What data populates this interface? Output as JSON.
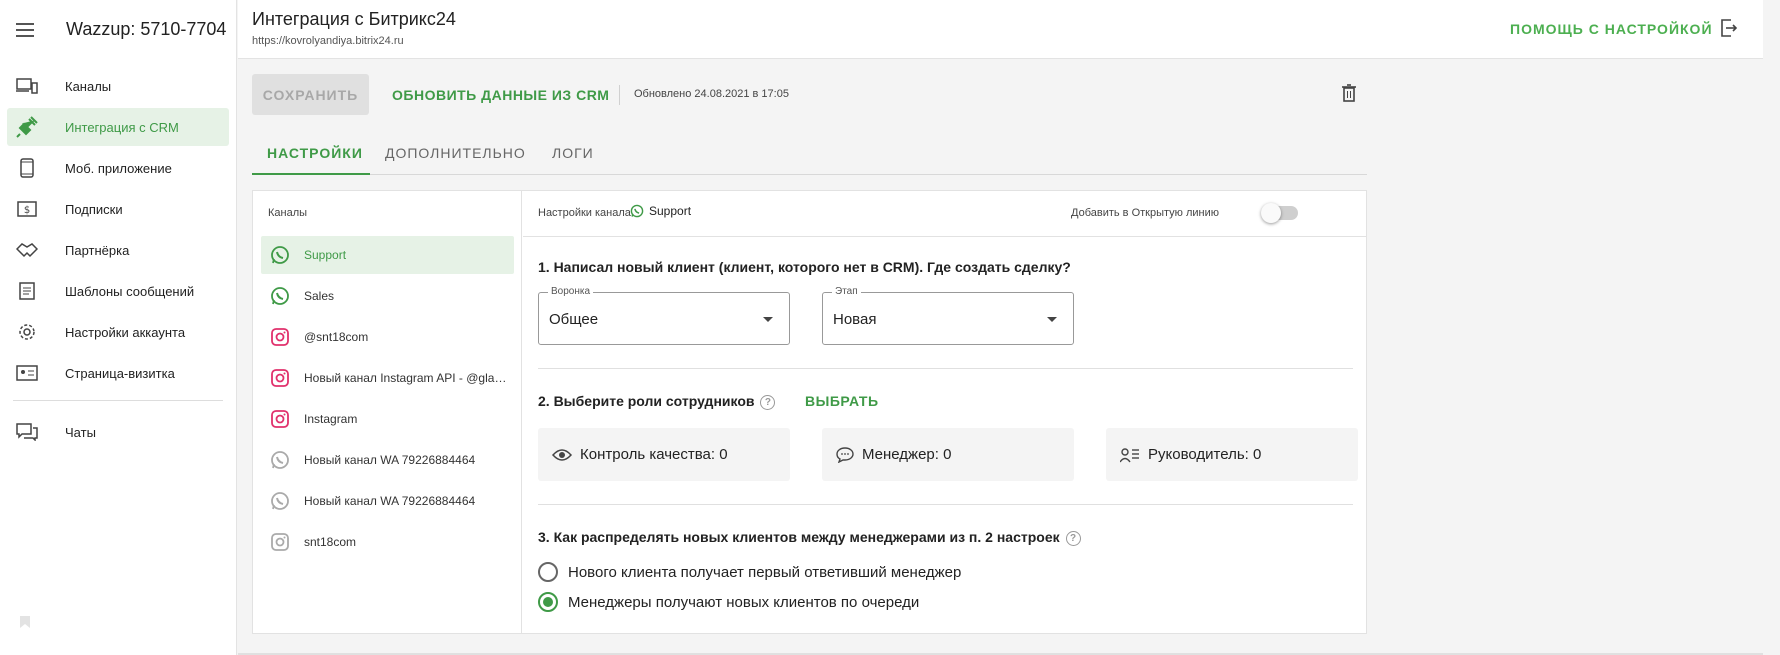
{
  "app": {
    "brand": "Wazzup: 5710-7704"
  },
  "sidebar": {
    "items": [
      {
        "label": "Каналы",
        "icon": "devices-icon",
        "active": false
      },
      {
        "label": "Интеграция с CRM",
        "icon": "plug-icon",
        "active": true
      },
      {
        "label": "Моб. приложение",
        "icon": "phone-icon",
        "active": false
      },
      {
        "label": "Подписки",
        "icon": "dollar-icon",
        "active": false
      },
      {
        "label": "Партнёрка",
        "icon": "handshake-icon",
        "active": false
      },
      {
        "label": "Шаблоны сообщений",
        "icon": "document-icon",
        "active": false
      },
      {
        "label": "Настройки аккаунта",
        "icon": "gear-icon",
        "active": false
      },
      {
        "label": "Страница-визитка",
        "icon": "card-icon",
        "active": false
      }
    ],
    "chats_label": "Чаты"
  },
  "header": {
    "title": "Интеграция с Битрикс24",
    "url": "https://kovrolyandiya.bitrix24.ru",
    "help_label": "ПОМОЩЬ С НАСТРОЙКОЙ"
  },
  "toolbar": {
    "save_label": "СОХРАНИТЬ",
    "refresh_label": "ОБНОВИТЬ ДАННЫЕ ИЗ CRM",
    "updated_text": "Обновлено 24.08.2021 в 17:05"
  },
  "tabs": [
    {
      "label": "НАСТРОЙКИ",
      "active": true
    },
    {
      "label": "ДОПОЛНИТЕЛЬНО",
      "active": false
    },
    {
      "label": "ЛОГИ",
      "active": false
    }
  ],
  "channels": {
    "header": "Каналы",
    "items": [
      {
        "label": "Support",
        "type": "whatsapp",
        "active": true
      },
      {
        "label": "Sales",
        "type": "whatsapp",
        "active": false
      },
      {
        "label": "@snt18com",
        "type": "instagram",
        "active": false
      },
      {
        "label": "Новый канал Instagram API - @glaz_dushi_and_zhizni",
        "type": "instagram",
        "active": false
      },
      {
        "label": "Instagram",
        "type": "instagram",
        "active": false
      },
      {
        "label": "Новый канал WA 79226884464",
        "type": "whatsapp-gray",
        "active": false
      },
      {
        "label": "Новый канал WA 79226884464",
        "type": "whatsapp-gray",
        "active": false
      },
      {
        "label": "snt18com",
        "type": "instagram-gray",
        "active": false
      }
    ]
  },
  "settings": {
    "header_label": "Настройки канала",
    "channel_name": "Support",
    "open_line_label": "Добавить в Открытую линию",
    "q1": "1. Написал новый клиент (клиент, которого нет в CRM). Где создать сделку?",
    "funnel_label": "Воронка",
    "funnel_value": "Общее",
    "stage_label": "Этап",
    "stage_value": "Новая",
    "q2": "2. Выберите роли сотрудников",
    "choose_label": "ВЫБРАТЬ",
    "roles": [
      {
        "label": "Контроль качества: 0",
        "icon": "eye-icon"
      },
      {
        "label": "Менеджер: 0",
        "icon": "chat-bubble-icon"
      },
      {
        "label": "Руководитель: 0",
        "icon": "user-list-icon"
      }
    ],
    "q3": "3. Как распределять новых клиентов между менеджерами из п. 2 настроек",
    "radio1": "Нового клиента получает первый ответивший менеджер",
    "radio2": "Менеджеры получают новых клиентов по очереди",
    "help_char": "?"
  },
  "colors": {
    "accent": "#3f9a47",
    "instagram": "#e1306c"
  }
}
